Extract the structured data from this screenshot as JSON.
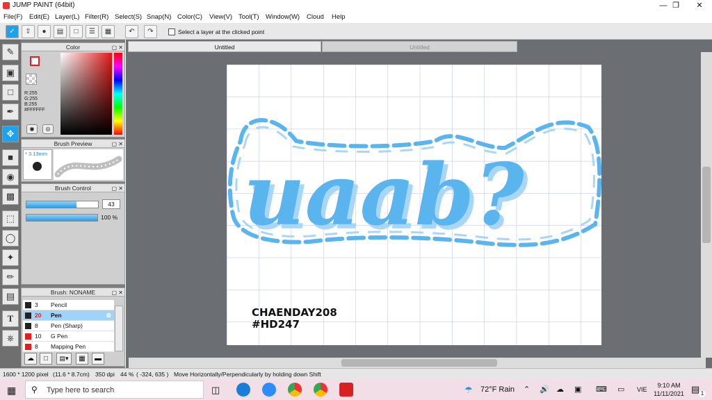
{
  "app": {
    "title": "JUMP PAINT (64bit)"
  },
  "menu": [
    "File(F)",
    "Edit(E)",
    "Layer(L)",
    "Filter(R)",
    "Select(S)",
    "Snap(N)",
    "Color(C)",
    "View(V)",
    "Tool(T)",
    "Window(W)",
    "Cloud",
    "Help"
  ],
  "toolbar": {
    "checkbox_label": "Select a layer at the clicked point"
  },
  "tabs": [
    "Untitled",
    "Untitled"
  ],
  "color_panel": {
    "title": "Color",
    "r": "R:255",
    "g": "G:255",
    "b": "B:255",
    "hex": "#FFFFFF"
  },
  "brush_preview": {
    "title": "Brush Preview",
    "size": "* 3.13mm"
  },
  "brush_control": {
    "title": "Brush Control",
    "size_value": "43",
    "size_fraction": 0.7,
    "opacity_value": "100 %",
    "opacity_fraction": 1.0
  },
  "brush_list": {
    "title": "Brush: NONAME",
    "items": [
      {
        "size": "3",
        "name": "Pencil",
        "color": "#222222"
      },
      {
        "size": "20",
        "name": "Pen",
        "color": "#222222",
        "selected": true
      },
      {
        "size": "8",
        "name": "Pen (Sharp)",
        "color": "#222222"
      },
      {
        "size": "10",
        "name": "G Pen",
        "color": "#e02020"
      },
      {
        "size": "8",
        "name": "Mapping Pen",
        "color": "#e02020"
      }
    ]
  },
  "canvas": {
    "artwork_text": "uaab?",
    "credit_line1": "CHAENDAY208",
    "credit_line2": "#HD247"
  },
  "status": {
    "size": "1600 * 1200 pixel",
    "physical": "(11.6 * 8.7cm)",
    "dpi": "350 dpi",
    "zoom": "44 %",
    "coords": "( -324, 635 )",
    "hint": "Move Horizontally/Perpendicularly by holding down Shift"
  },
  "taskbar": {
    "search_placeholder": "Type here to search",
    "weather": "72°F  Rain",
    "lang": "VIE",
    "time": "9:10 AM",
    "date": "11/11/2021",
    "notification_count": "1"
  },
  "colors": {
    "accent": "#1aa3f0",
    "art_blue": "#5ab4ee",
    "art_light": "#a9d6f7"
  }
}
